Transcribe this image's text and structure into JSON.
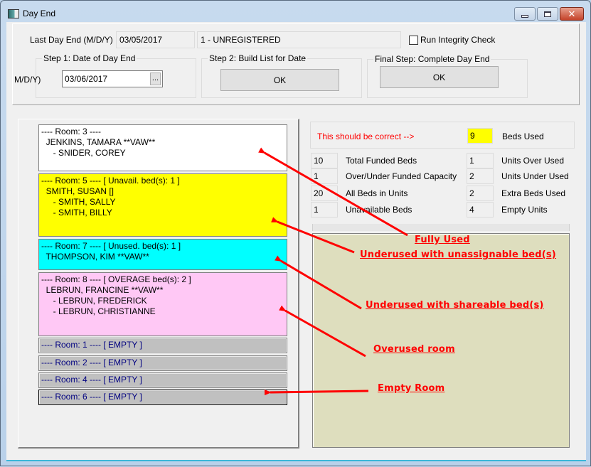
{
  "window": {
    "title": "Day End",
    "icon": "app-window-icon",
    "controls": {
      "minimize": "minimize-icon",
      "maximize": "maximize-icon",
      "close": "close-icon",
      "close_glyph": "✕"
    }
  },
  "header": {
    "last_day_end_label": "Last Day End (M/D/Y)",
    "last_day_end_value": "03/05/2017",
    "registration_status": "1 - UNREGISTERED",
    "integrity_check_label": "Run Integrity Check",
    "integrity_check_checked": false
  },
  "step1": {
    "title": "Step 1: Date of Day End",
    "date_label": "(M/D/Y)",
    "date_value": "03/06/2017",
    "picker_label": "..."
  },
  "step2": {
    "title": "Step 2: Build List for Date",
    "button_label": "OK"
  },
  "final_step": {
    "title": "Final Step: Complete Day End",
    "button_label": "OK"
  },
  "rooms": [
    {
      "status": "fully-used",
      "color": "#ffffff",
      "lines": [
        "---- Room: 3 ----",
        "  JENKINS, TAMARA **VAW**",
        "     - SNIDER, COREY"
      ]
    },
    {
      "status": "unavailable",
      "color": "#ffff00",
      "lines": [
        "---- Room: 5 ---- [ Unavail. bed(s): 1 ]",
        "  SMITH, SUSAN []",
        "     - SMITH, SALLY",
        "     - SMITH, BILLY"
      ]
    },
    {
      "status": "unused",
      "color": "#00ffff",
      "lines": [
        "---- Room: 7 ---- [ Unused. bed(s): 1 ]",
        "  THOMPSON, KIM **VAW**"
      ]
    },
    {
      "status": "overage",
      "color": "#ffc8f5",
      "lines": [
        "---- Room: 8 ---- [ OVERAGE bed(s): 2 ]",
        "  LEBRUN, FRANCINE **VAW**",
        "     - LEBRUN, FREDERICK",
        "     - LEBRUN, CHRISTIANNE"
      ]
    },
    {
      "status": "empty",
      "color": "#c0c0c0",
      "lines": [
        "---- Room: 1 ---- [ EMPTY ]"
      ]
    },
    {
      "status": "empty",
      "color": "#c0c0c0",
      "lines": [
        "---- Room: 2 ---- [ EMPTY ]"
      ]
    },
    {
      "status": "empty",
      "color": "#c0c0c0",
      "lines": [
        "---- Room: 4 ---- [ EMPTY ]"
      ]
    },
    {
      "status": "empty",
      "color": "#c0c0c0",
      "lines": [
        "---- Room: 6 ---- [ EMPTY ]"
      ],
      "focused": true
    }
  ],
  "stats": {
    "hint": "This should be correct -->",
    "hint_color": "#ff0000",
    "beds_used": {
      "label": "Beds Used",
      "value": "9"
    },
    "left": [
      {
        "label": "Total Funded Beds",
        "value": "10"
      },
      {
        "label": "Over/Under Funded Capacity",
        "value": "1"
      },
      {
        "label": "All Beds in Units",
        "value": "20"
      },
      {
        "label": "Unavailable Beds",
        "value": "1"
      }
    ],
    "right": [
      {
        "label": "Units Over Used",
        "value": "1"
      },
      {
        "label": "Units Under Used",
        "value": "2"
      },
      {
        "label": "Extra Beds Used",
        "value": "2"
      },
      {
        "label": "Empty Units",
        "value": "4"
      }
    ]
  },
  "annotations": [
    {
      "text": "Fully Used"
    },
    {
      "text": "Underused with unassignable bed(s)"
    },
    {
      "text": "Underused with shareable bed(s)"
    },
    {
      "text": "Overused room"
    },
    {
      "text": "Empty Room"
    }
  ],
  "colors": {
    "annotation": "#ff0000",
    "notes_background": "#dedebe",
    "empty_room_text": "#000080"
  }
}
